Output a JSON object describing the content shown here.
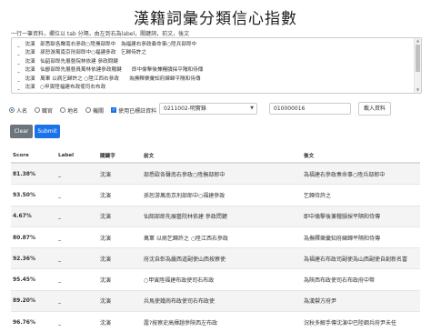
{
  "title": "漢籍詞彙分類信心指數",
  "hint": "一行一筆資料，欄位以 tab 分隔，由左到右為label，關鍵詞，前文，後文",
  "textarea_lines": [
    "_　沈演　部悉歐各聲南右參政○陞撫部郎中　為福建右參政奏命事○陞兵部郎中",
    "_　沈演　孫恕游萬南京刑部郎中○福建參政　乞歸侍許之",
    "_　沈演　仙韶部郎先展藝院林依建 參政問鍵",
    "_　沈演　仙鄙部郎先展藝員萬林依建參政賤鍵　　即中倫擊後兼糧牘採平隔和侍傳",
    "_　沈演　萬軍 以病乞歸許之 ○陞江西右參政　　為撫釋樂彙知府練歸平隔和侍傳",
    "_　沈演　○甲寅陞福建布政使司右布政"
  ],
  "options": {
    "radios": [
      {
        "label": "人名",
        "checked": true
      },
      {
        "label": "職官",
        "checked": false
      },
      {
        "label": "地名",
        "checked": false
      },
      {
        "label": "機關",
        "checked": false
      }
    ],
    "checkbox_label": "使用已標註資料",
    "select_value": "0211002-明實錄",
    "input_value": "010000016",
    "load_button": "載入資料"
  },
  "buttons": {
    "clear": "Clear",
    "submit": "Submit"
  },
  "table": {
    "headers": [
      "Score",
      "Label",
      "關鍵字",
      "前文",
      "後文"
    ],
    "rows": [
      [
        "81.38%",
        "_",
        "沈演",
        "部悉歐各聲南右參政○陞撫部郎中",
        "為福建右參政奏命事○陞兵部郎中"
      ],
      [
        "93.50%",
        "_",
        "沈演",
        "孫恕游萬南京刑部郎中○福建參政",
        "乞歸侍許之"
      ],
      [
        "4.67%",
        "_",
        "沈演",
        "仙韶部郎先展藝院林依建 參政問鍵",
        "即中倫擊後兼糧牘採平隔和侍傳"
      ],
      [
        "80.87%",
        "_",
        "沈演",
        "萬軍 以病乞歸許之 ○陞江西右參政",
        "為撫釋樂彙知府練歸平隔和侍傳"
      ],
      [
        "92.36%",
        "_",
        "沈演",
        "府沈自彰為嚴西道副使山西按察使",
        "為福建右布政司副使為山西副使自創新名富"
      ],
      [
        "95.45%",
        "_",
        "沈演",
        "○甲寅陞福建布政使司右布政",
        "為陝西布政使司右布政府中幣"
      ],
      [
        "89.20%",
        "_",
        "沈演",
        "兵馬使鐵崗布政使司右布政使",
        "為漢禦方府尹"
      ],
      [
        "96.76%",
        "_",
        "沈演",
        "露?按察史高揮趙參陝西左布政",
        "況秋多解手傳沈演中巴陸鋼兵府尹未任"
      ]
    ]
  }
}
